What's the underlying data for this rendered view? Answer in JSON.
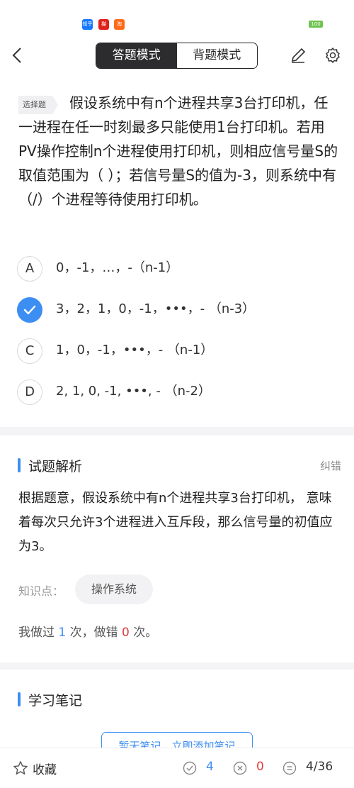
{
  "header": {
    "mode_answer": "答题模式",
    "mode_recite": "背题模式"
  },
  "question": {
    "tag": "选择题",
    "text": "假设系统中有n个进程共享3台打印机，任一进程在任一时刻最多只能使用1台打印机。若用PV操作控制n个进程使用打印机，则相应信号量S的取值范围为（ ）；若信号量S的值为-3，则系统中有（/）个进程等待使用打印机。",
    "options": [
      {
        "letter": "A",
        "text": "0，-1，…，-（n-1）",
        "selected": false
      },
      {
        "letter": "B",
        "text": "3，2，1，0，-1，•••，-  （n-3）",
        "selected": true
      },
      {
        "letter": "C",
        "text": "1，0，-1，•••，-  （n-1）",
        "selected": false
      },
      {
        "letter": "D",
        "text": "2, 1, 0, -1, •••, -  （n-2）",
        "selected": false
      }
    ]
  },
  "analysis": {
    "title": "试题解析",
    "fix_label": "纠错",
    "text": "根据题意，假设系统中有n个进程共享3台打印机， 意味着每次只允许3个进程进入互斥段，那么信号量的初值应为3。",
    "knowledge_label": "知识点：",
    "knowledge_value": "操作系统",
    "stats": {
      "prefix": "我做过",
      "done": "1",
      "mid": "次，做错",
      "wrong": "0",
      "suffix": "次。"
    }
  },
  "notes": {
    "title": "学习笔记",
    "button": "暂无笔记，立即添加笔记"
  },
  "bottom": {
    "favorite": "收藏",
    "correct_count": "4",
    "wrong_count": "0",
    "progress": "4/36"
  },
  "status": {
    "battery": "100"
  },
  "colors": {
    "accent": "#3d8ef2",
    "error": "#e23c3c",
    "segment_active": "#2c2c2e"
  }
}
